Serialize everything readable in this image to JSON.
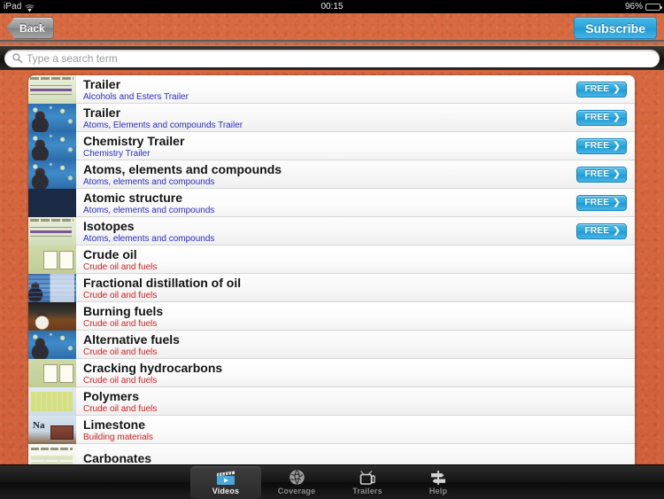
{
  "status_bar": {
    "device": "iPad",
    "wifi_icon": "wifi-icon",
    "time": "00:15",
    "battery_percent": "96%",
    "battery_icon": "battery-icon"
  },
  "nav_bar": {
    "back_label": "Back",
    "subscribe_label": "Subscribe"
  },
  "search": {
    "placeholder": "Type a search term",
    "value": "",
    "icon": "search-icon"
  },
  "colors": {
    "background_orange": "#d4643c",
    "accent_blue": "#2aa5dc",
    "subtitle_free": "#2b2bd8",
    "subtitle_paid": "#e02020",
    "tabbar_dark": "#151515"
  },
  "list": {
    "rows": [
      {
        "title": "Trailer",
        "subtitle": "Alcohols and Esters Trailer",
        "subtitle_color": "blue",
        "badge": "FREE",
        "thumb": "t-slide"
      },
      {
        "title": "Trailer",
        "subtitle": "Atoms, Elements and compounds Trailer",
        "subtitle_color": "blue",
        "badge": "FREE",
        "thumb": "t-person-blue"
      },
      {
        "title": "Chemistry Trailer",
        "subtitle": "Chemistry Trailer",
        "subtitle_color": "blue",
        "badge": "FREE",
        "thumb": "t-person-blue"
      },
      {
        "title": "Atoms, elements and compounds",
        "subtitle": "Atoms, elements and compounds",
        "subtitle_color": "blue",
        "badge": "FREE",
        "thumb": "t-person-blue"
      },
      {
        "title": "Atomic structure",
        "subtitle": "Atoms, elements and compounds",
        "subtitle_color": "blue",
        "badge": "FREE",
        "thumb": "t-chem-red"
      },
      {
        "title": "Isotopes",
        "subtitle": "Atoms, elements and compounds",
        "subtitle_color": "blue",
        "badge": "FREE",
        "thumb": "t-slide"
      },
      {
        "title": "Crude oil",
        "subtitle": "Crude oil and fuels",
        "subtitle_color": "red",
        "badge": "",
        "thumb": "t-green-cards"
      },
      {
        "title": "Fractional distillation of oil",
        "subtitle": "Crude oil and fuels",
        "subtitle_color": "red",
        "badge": "",
        "thumb": "t-person-chart"
      },
      {
        "title": "Burning fuels",
        "subtitle": "Crude oil and fuels",
        "subtitle_color": "red",
        "badge": "",
        "thumb": "t-person-dark"
      },
      {
        "title": "Alternative fuels",
        "subtitle": "Crude oil and fuels",
        "subtitle_color": "red",
        "badge": "",
        "thumb": "t-person-blue"
      },
      {
        "title": "Cracking hydrocarbons",
        "subtitle": "Crude oil and fuels",
        "subtitle_color": "red",
        "badge": "",
        "thumb": "t-green-cards"
      },
      {
        "title": "Polymers",
        "subtitle": "Crude oil and fuels",
        "subtitle_color": "red",
        "badge": "",
        "thumb": "t-periodic"
      },
      {
        "title": "Limestone",
        "subtitle": "Building materials",
        "subtitle_color": "red",
        "badge": "",
        "thumb": "t-na-block"
      },
      {
        "title": "Carbonates",
        "subtitle": "",
        "subtitle_color": "red",
        "badge": "",
        "thumb": "t-table-light"
      }
    ]
  },
  "tab_bar": {
    "tabs": [
      {
        "label": "Videos",
        "icon": "film-clapper-icon",
        "active": true
      },
      {
        "label": "Coverage",
        "icon": "globe-icon",
        "active": false
      },
      {
        "label": "Trailers",
        "icon": "television-icon",
        "active": false
      },
      {
        "label": "Help",
        "icon": "signpost-icon",
        "active": false
      }
    ]
  }
}
